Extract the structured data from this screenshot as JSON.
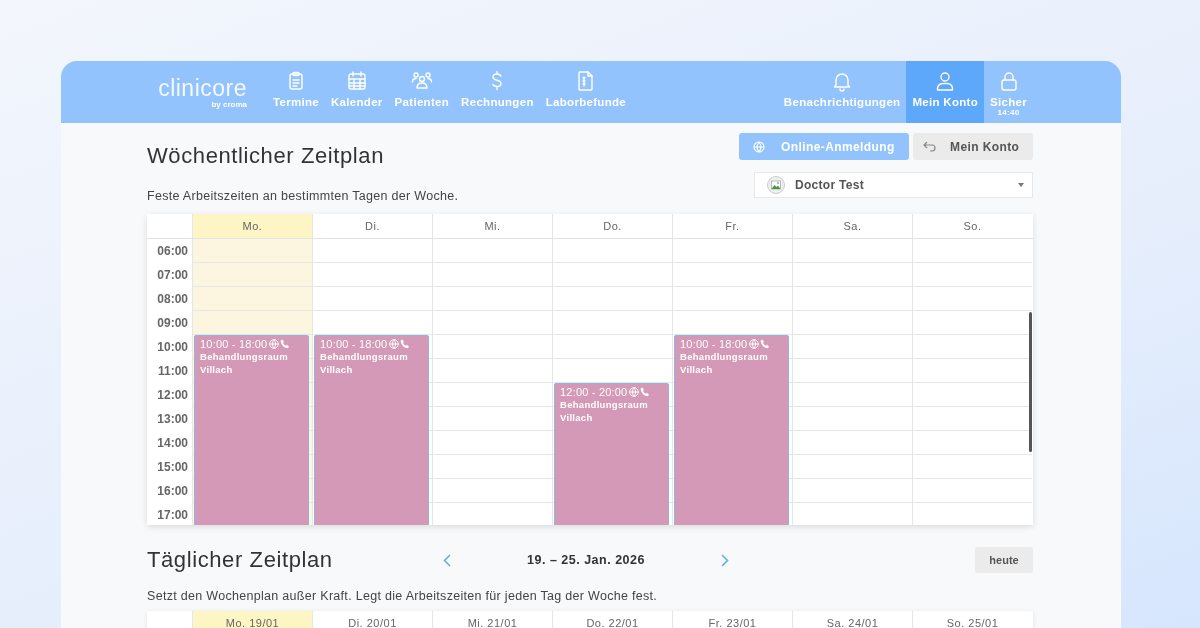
{
  "header": {
    "logo": "clinicore",
    "logo_sub": "by croma",
    "nav": [
      {
        "label": "Termine",
        "selected": false
      },
      {
        "label": "Kalender",
        "selected": false
      },
      {
        "label": "Patienten",
        "selected": false
      },
      {
        "label": "Rechnungen",
        "selected": false
      },
      {
        "label": "Laborbefunde",
        "selected": false
      }
    ],
    "nav_right": [
      {
        "label": "Benachrichtigungen",
        "selected": false
      },
      {
        "label": "Mein Konto",
        "selected": true
      },
      {
        "label": "Sicher",
        "selected": false,
        "sub": "14:40"
      }
    ]
  },
  "weekly": {
    "title": "Wöchentlicher Zeitplan",
    "subtitle": "Feste Arbeitszeiten an bestimmten Tagen der Woche.",
    "buttons": [
      {
        "label": "Online-Anmeldung",
        "kind": "primary"
      },
      {
        "label": "Mein Konto",
        "kind": "secondary"
      }
    ],
    "doctor_select": {
      "value": "Doctor Test"
    },
    "times": [
      "06:00",
      "07:00",
      "08:00",
      "09:00",
      "10:00",
      "11:00",
      "12:00",
      "13:00",
      "14:00",
      "15:00",
      "16:00",
      "17:00"
    ],
    "days": [
      {
        "label": "Mo.",
        "selected": true,
        "events": [
          {
            "time": "10:00 - 18:00",
            "room": "Behandlungsraum Villach"
          }
        ]
      },
      {
        "label": "Di.",
        "selected": false,
        "events": [
          {
            "time": "10:00 - 18:00",
            "room": "Behandlungsraum Villach"
          }
        ]
      },
      {
        "label": "Mi.",
        "selected": false
      },
      {
        "label": "Do.",
        "selected": false,
        "events": [
          {
            "time": "12:00 - 20:00",
            "room": "Behandlungsraum Villach"
          }
        ]
      },
      {
        "label": "Fr.",
        "selected": false,
        "events": [
          {
            "time": "10:00 - 18:00",
            "room": "Behandlungsraum Villach"
          }
        ]
      },
      {
        "label": "Sa.",
        "selected": false
      },
      {
        "label": "So.",
        "selected": false
      }
    ]
  },
  "daily": {
    "title": "Täglicher Zeitplan",
    "range": "19. – 25. Jan. 2026",
    "today_button": "heute",
    "subtitle": "Setzt den Wochenplan außer Kraft. Legt die Arbeitszeiten für jeden Tag der Woche fest.",
    "days": [
      {
        "label": "Mo. 19/01",
        "selected": true
      },
      {
        "label": "Di. 20/01",
        "selected": false
      },
      {
        "label": "Mi. 21/01",
        "selected": false
      },
      {
        "label": "Do. 22/01",
        "selected": false
      },
      {
        "label": "Fr. 23/01",
        "selected": false
      },
      {
        "label": "Sa. 24/01",
        "selected": false
      },
      {
        "label": "So. 25/01",
        "selected": false
      }
    ]
  }
}
